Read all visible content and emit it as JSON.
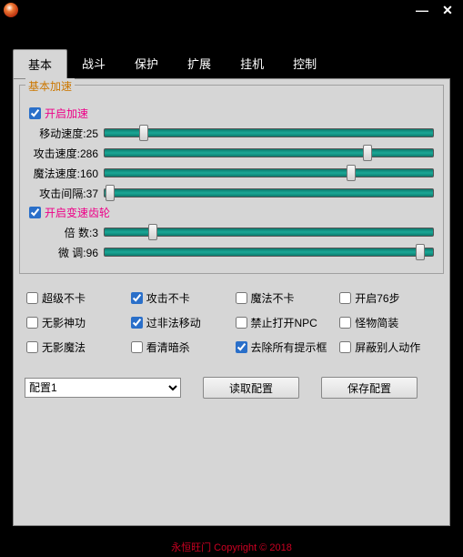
{
  "tabs": {
    "t0": "基本",
    "t1": "战斗",
    "t2": "保护",
    "t3": "扩展",
    "t4": "挂机",
    "t5": "控制"
  },
  "legend": "基本加速",
  "enable_speed": {
    "label": "开启加速",
    "checked": true
  },
  "sliders": {
    "move": {
      "label": "移动速度:",
      "value": "25",
      "pos": 12
    },
    "attack": {
      "label": "攻击速度:",
      "value": "286",
      "pos": 80
    },
    "magic": {
      "label": "魔法速度:",
      "value": "160",
      "pos": 75
    },
    "gap": {
      "label": "攻击间隔:",
      "value": "37",
      "pos": 2
    },
    "mult": {
      "label": "倍    数:",
      "value": "3",
      "pos": 15
    },
    "fine": {
      "label": "微    调:",
      "value": "96",
      "pos": 96
    }
  },
  "enable_gear": {
    "label": "开启变速齿轮",
    "checked": true
  },
  "grid": {
    "c0": {
      "label": "超级不卡",
      "checked": false
    },
    "c1": {
      "label": "攻击不卡",
      "checked": true
    },
    "c2": {
      "label": "魔法不卡",
      "checked": false
    },
    "c3": {
      "label": "开启76步",
      "checked": false
    },
    "c4": {
      "label": "无影神功",
      "checked": false
    },
    "c5": {
      "label": "过非法移动",
      "checked": true
    },
    "c6": {
      "label": "禁止打开NPC",
      "checked": false
    },
    "c7": {
      "label": "怪物简装",
      "checked": false
    },
    "c8": {
      "label": "无影魔法",
      "checked": false
    },
    "c9": {
      "label": "看清暗杀",
      "checked": false
    },
    "c10": {
      "label": "去除所有提示框",
      "checked": true
    },
    "c11": {
      "label": "屏蔽别人动作",
      "checked": false
    }
  },
  "config_select": "配置1",
  "btn_load": "读取配置",
  "btn_save": "保存配置",
  "footer": "永恒旺门   Copyright © 2018"
}
